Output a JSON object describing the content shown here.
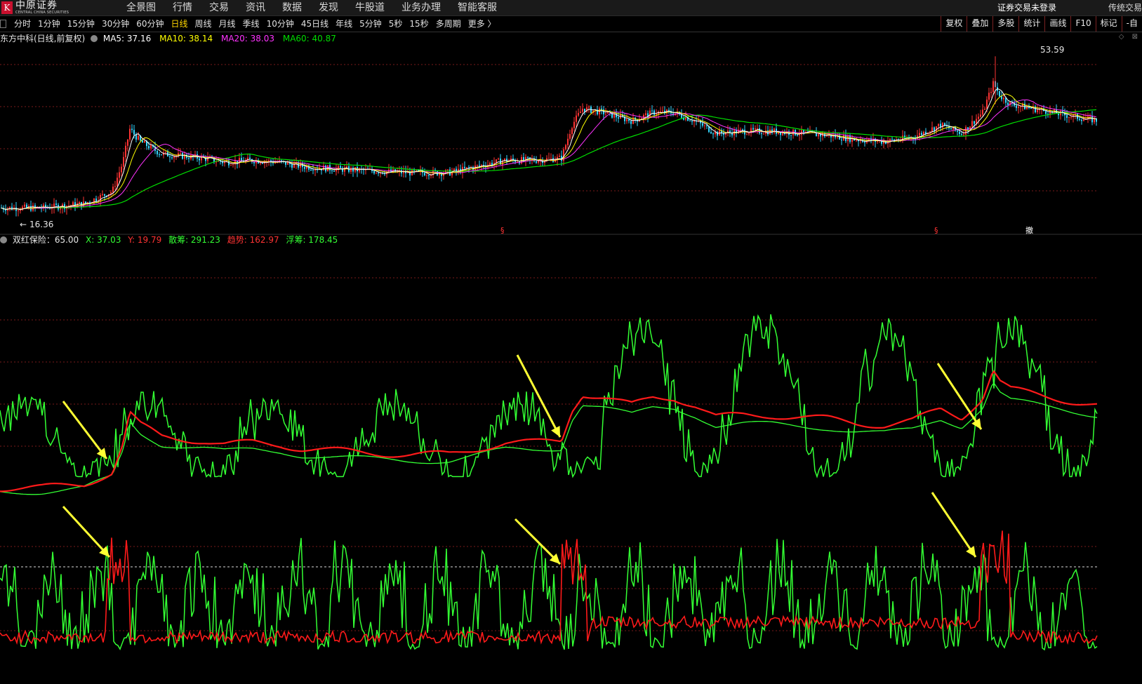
{
  "header": {
    "logo_cn": "中原证券",
    "logo_en": "CENTRAL CHINA SECURITIES",
    "menu": [
      "全景图",
      "行情",
      "交易",
      "资讯",
      "数据",
      "发现",
      "牛股道",
      "业务办理",
      "智能客服"
    ],
    "login_status": "证券交易未登录",
    "trad_trade": "传统交易"
  },
  "toolbar": {
    "periods": [
      "分时",
      "1分钟",
      "15分钟",
      "30分钟",
      "60分钟",
      "日线",
      "周线",
      "月线",
      "季线",
      "10分钟",
      "45日线",
      "年线",
      "5分钟",
      "5秒",
      "15秒",
      "多周期",
      "更多 〉"
    ],
    "active_period": "日线",
    "right_tools": [
      "复权",
      "叠加",
      "多股",
      "统计",
      "画线",
      "F10",
      "标记",
      "-自"
    ]
  },
  "price_panel": {
    "stock_title": "东方中科(日线,前复权)",
    "ma5_label": "MA5: 37.16",
    "ma10_label": "MA10: 38.14",
    "ma20_label": "MA20: 38.03",
    "ma60_label": "MA60: 40.87",
    "high_label": "53.59",
    "low_label": "16.36",
    "event_markers": [
      "§",
      "§",
      "撤"
    ]
  },
  "indicator_panel": {
    "name": "双红保险：65.00",
    "x_label": "X: 37.03",
    "y_label": "Y: 19.79",
    "san_label": "散筹: 291.23",
    "trend_label": "趋势: 162.97",
    "float_label": "浮筹: 178.45"
  },
  "colors": {
    "up": "#ff3333",
    "down": "#33d6ff",
    "ma5": "#ffffff",
    "ma10": "#ffff00",
    "ma20": "#ff33ff",
    "ma60": "#00dd00",
    "green_line": "#33ff33",
    "red_line": "#ff1a1a",
    "arrow": "#ffff33",
    "grid": "#7a1a1a"
  },
  "chart_data": {
    "type": "line",
    "note_type": "candlestick-with-indicators",
    "price": {
      "high": 53.59,
      "low": 16.36,
      "close_path_x": [
        0,
        60,
        120,
        160,
        175,
        185,
        200,
        230,
        260,
        290,
        320,
        360,
        400,
        430,
        470,
        520,
        580,
        640,
        680,
        720,
        760,
        800,
        815,
        830,
        860,
        900,
        930,
        960,
        990,
        1020,
        1060,
        1100,
        1140,
        1180,
        1220,
        1260,
        1300,
        1340,
        1370,
        1400,
        1415,
        1425,
        1440,
        1470,
        1500,
        1530,
        1565
      ],
      "close_path_y": [
        17,
        17,
        18,
        21,
        28,
        36,
        33,
        30,
        29.5,
        29,
        28,
        28.5,
        28,
        27,
        26.5,
        26,
        25.5,
        25.5,
        27,
        28.5,
        28.5,
        29,
        37,
        41,
        40,
        38,
        40,
        40,
        38,
        35,
        35.5,
        35.5,
        35,
        34.5,
        33.5,
        33,
        34,
        37,
        35,
        40,
        47,
        44,
        42,
        41,
        40,
        39,
        38
      ]
    }
  }
}
